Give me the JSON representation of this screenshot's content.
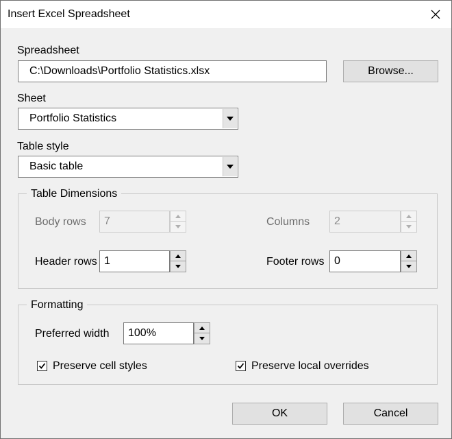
{
  "window": {
    "title": "Insert Excel Spreadsheet"
  },
  "spreadsheet": {
    "label": "Spreadsheet",
    "value": "C:\\Downloads\\Portfolio Statistics.xlsx",
    "browse_label": "Browse..."
  },
  "sheet": {
    "label": "Sheet",
    "value": "Portfolio Statistics"
  },
  "table_style": {
    "label": "Table style",
    "value": "Basic table"
  },
  "dimensions": {
    "title": "Table Dimensions",
    "body_rows": {
      "label": "Body rows",
      "value": "7"
    },
    "columns": {
      "label": "Columns",
      "value": "2"
    },
    "header_rows": {
      "label": "Header rows",
      "value": "1"
    },
    "footer_rows": {
      "label": "Footer rows",
      "value": "0"
    }
  },
  "formatting": {
    "title": "Formatting",
    "preferred_width": {
      "label": "Preferred width",
      "value": "100%"
    },
    "preserve_cell_styles": {
      "label": "Preserve cell styles",
      "checked": true
    },
    "preserve_local_overrides": {
      "label": "Preserve local overrides",
      "checked": true
    }
  },
  "buttons": {
    "ok": "OK",
    "cancel": "Cancel"
  },
  "icons": {
    "close": "close-icon",
    "dropdown": "chevron-down-icon",
    "spin_up": "spin-up-icon",
    "spin_down": "spin-down-icon",
    "check": "check-icon"
  }
}
